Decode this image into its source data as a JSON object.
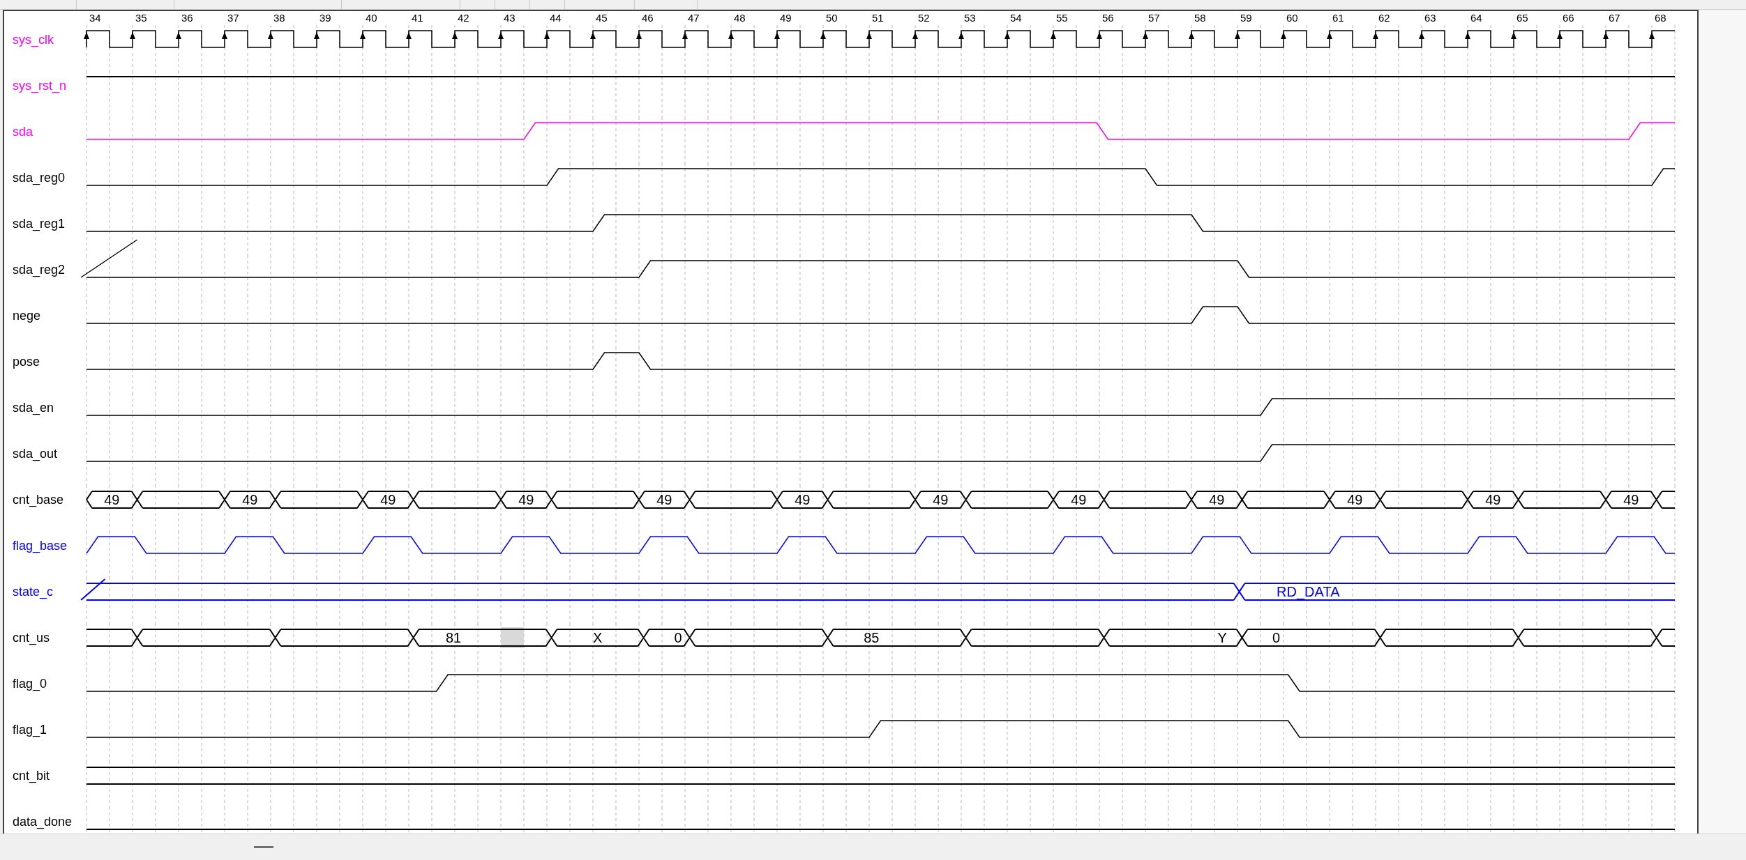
{
  "timeline": {
    "ticks": [
      "34",
      "35",
      "36",
      "37",
      "38",
      "39",
      "40",
      "41",
      "42",
      "43",
      "44",
      "45",
      "46",
      "47",
      "48",
      "49",
      "50",
      "51",
      "52",
      "53",
      "54",
      "55",
      "56",
      "57",
      "58",
      "59",
      "60",
      "61",
      "62",
      "63",
      "64",
      "65",
      "66",
      "67",
      "68"
    ]
  },
  "signals": [
    {
      "name": "sys_clk",
      "kind": "clock",
      "color": "#ff00ff",
      "wave": {
        "color": "#000000"
      }
    },
    {
      "name": "sys_rst_n",
      "kind": "bit",
      "color": "#ff00ff",
      "wave": {
        "color": "#000000"
      }
    },
    {
      "name": "sda",
      "kind": "bit",
      "color": "#ff00ff",
      "wave": {
        "color": "#ff00ff"
      }
    },
    {
      "name": "sda_reg0",
      "kind": "bit",
      "color": "#000000",
      "wave": {
        "color": "#000000"
      }
    },
    {
      "name": "sda_reg1",
      "kind": "bit",
      "color": "#000000",
      "wave": {
        "color": "#000000"
      }
    },
    {
      "name": "sda_reg2",
      "kind": "bit",
      "color": "#000000",
      "wave": {
        "color": "#000000"
      }
    },
    {
      "name": "nege",
      "kind": "bit",
      "color": "#000000",
      "wave": {
        "color": "#000000"
      }
    },
    {
      "name": "pose",
      "kind": "bit",
      "color": "#000000",
      "wave": {
        "color": "#000000"
      }
    },
    {
      "name": "sda_en",
      "kind": "bit",
      "color": "#000000",
      "wave": {
        "color": "#000000"
      }
    },
    {
      "name": "sda_out",
      "kind": "bit",
      "color": "#000000",
      "wave": {
        "color": "#000000"
      }
    },
    {
      "name": "cnt_base",
      "kind": "bus",
      "color": "#000000",
      "wave": {
        "color": "#000000"
      },
      "values": [
        "49",
        "49",
        "49",
        "49",
        "49",
        "49",
        "49",
        "49",
        "49",
        "49",
        "49",
        "49"
      ]
    },
    {
      "name": "flag_base",
      "kind": "bit",
      "color": "#0000ff",
      "wave": {
        "color": "#0000ff"
      }
    },
    {
      "name": "state_c",
      "kind": "bus",
      "color": "#0000ff",
      "wave": {
        "color": "#0000ff"
      },
      "values": [
        "RD_DATA"
      ]
    },
    {
      "name": "cnt_us",
      "kind": "bus",
      "color": "#000000",
      "wave": {
        "color": "#000000"
      },
      "values": [
        "81",
        "X",
        "0",
        "85",
        "Y",
        "0"
      ]
    },
    {
      "name": "flag_0",
      "kind": "bit",
      "color": "#000000",
      "wave": {
        "color": "#000000"
      }
    },
    {
      "name": "flag_1",
      "kind": "bit",
      "color": "#000000",
      "wave": {
        "color": "#000000"
      }
    },
    {
      "name": "cnt_bit",
      "kind": "bus",
      "color": "#000000",
      "wave": {
        "color": "#000000"
      }
    },
    {
      "name": "data_done",
      "kind": "bit",
      "color": "#000000",
      "wave": {
        "color": "#000000"
      }
    }
  ]
}
